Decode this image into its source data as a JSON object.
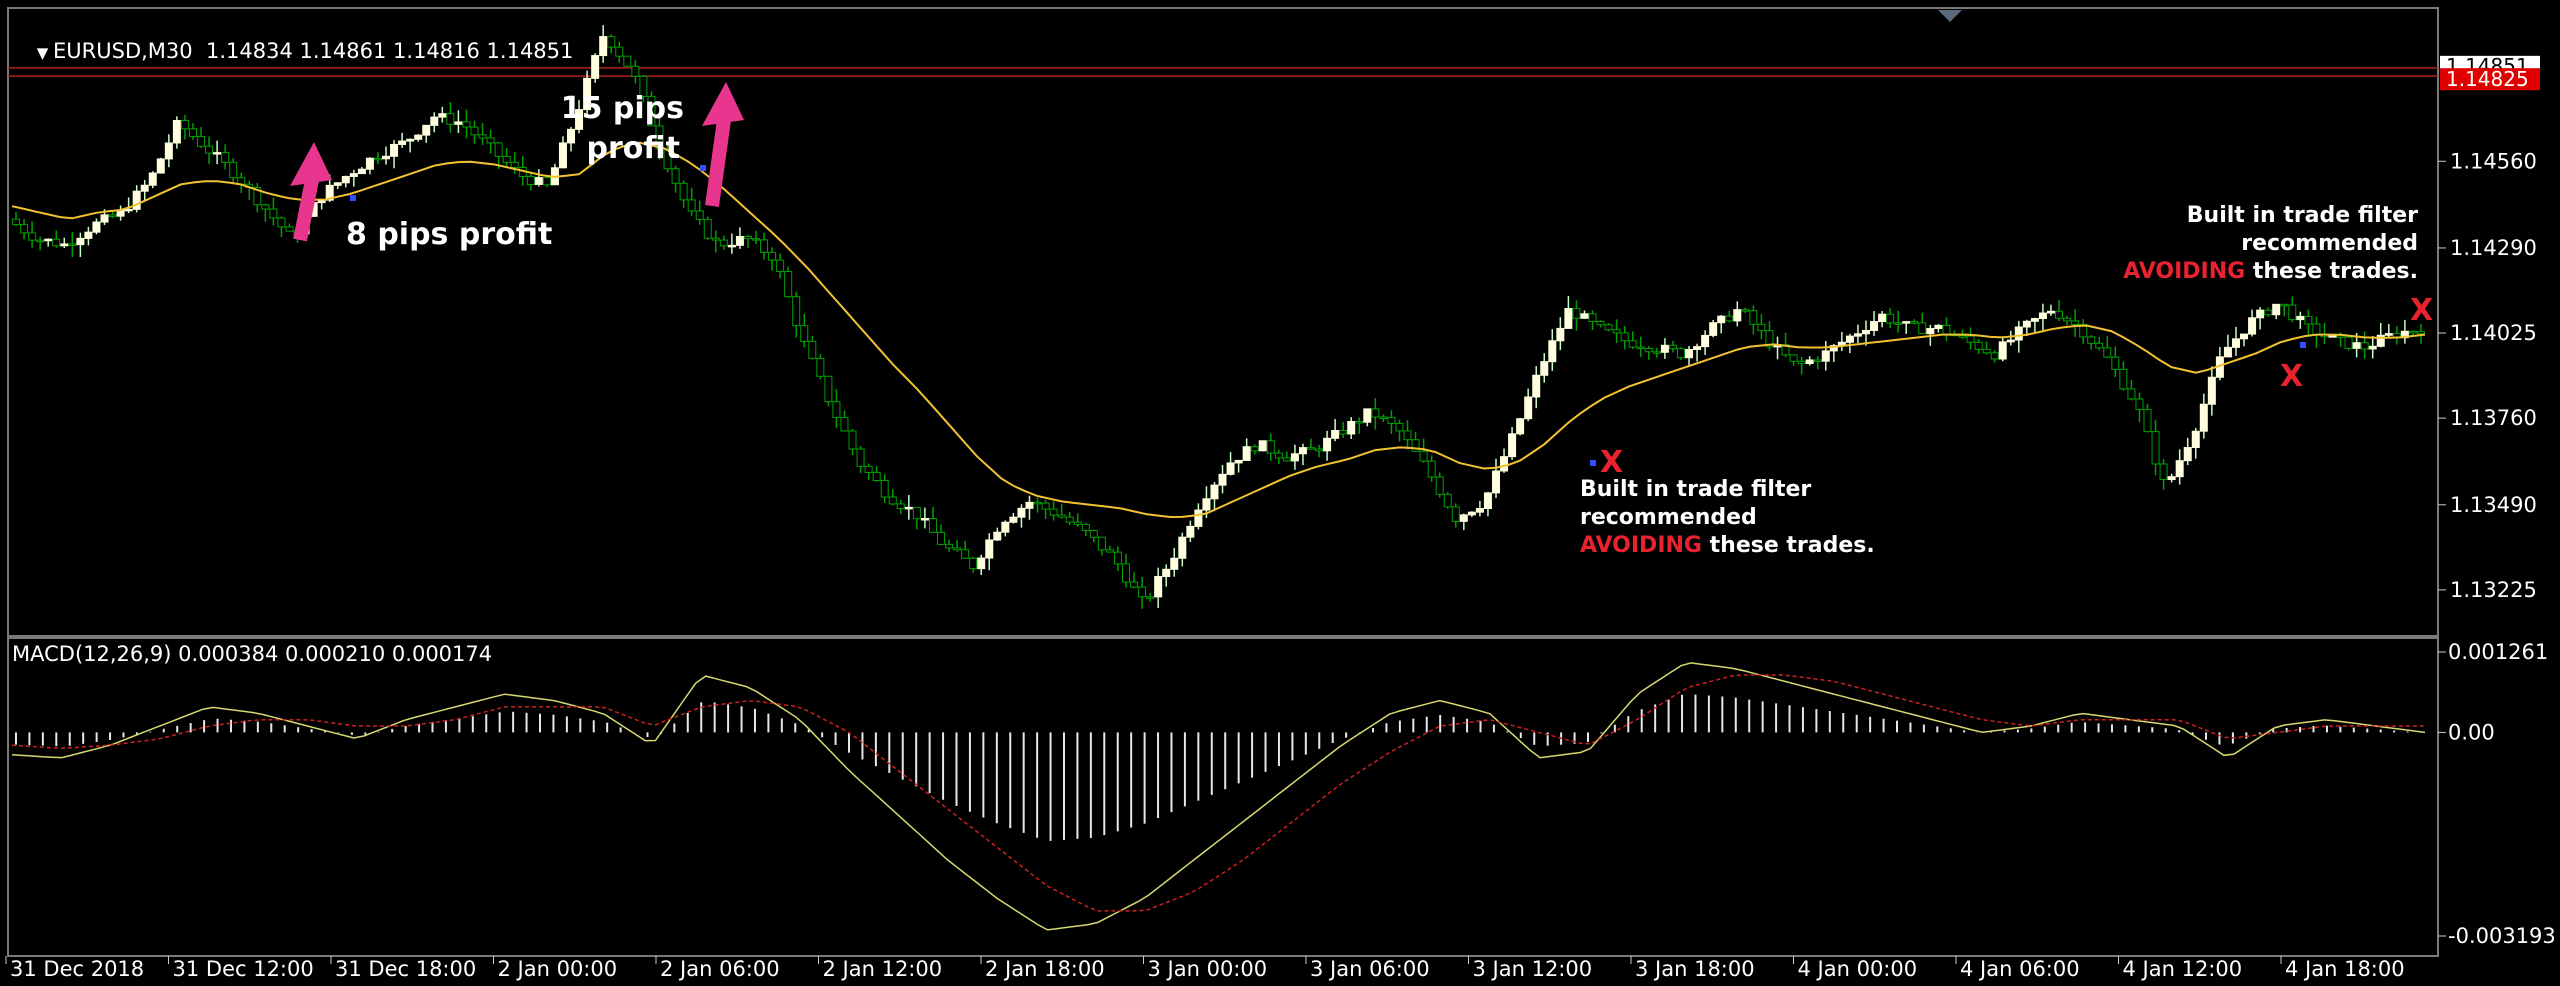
{
  "symbol_header": {
    "symbol": "EURUSD,M30",
    "ohlc": "1.14834 1.14861 1.14816 1.14851"
  },
  "macd_header": "MACD(12,26,9) 0.000384 0.000210 0.000174",
  "colors": {
    "background": "#000000",
    "bull_candle": "#ffffe0",
    "bear_candle": "#00a000",
    "moving_average": "#f2c230",
    "macd_signal": "#d02020",
    "annotation_arrow": "#e8368f",
    "annotation_red": "#e8232f",
    "bid_line": "#b02020"
  },
  "chart_data": [
    {
      "type": "candlestick",
      "panel": "main",
      "y_ticks": [
        "1.14560",
        "1.14290",
        "1.14025",
        "1.13760",
        "1.13490",
        "1.13225"
      ],
      "current_price": "1.14851",
      "red_price": "1.14825",
      "x_ticks": [
        "31 Dec 2018",
        "31 Dec 12:00",
        "31 Dec 18:00",
        "2 Jan 00:00",
        "2 Jan 06:00",
        "2 Jan 12:00",
        "2 Jan 18:00",
        "3 Jan 00:00",
        "3 Jan 06:00",
        "3 Jan 12:00",
        "3 Jan 18:00",
        "4 Jan 00:00",
        "4 Jan 06:00",
        "4 Jan 12:00",
        "4 Jan 18:00"
      ],
      "close_path": [
        1.1438,
        1.1432,
        1.143,
        1.1436,
        1.144,
        1.145,
        1.1468,
        1.146,
        1.1452,
        1.1442,
        1.1432,
        1.1445,
        1.1452,
        1.1458,
        1.1462,
        1.147,
        1.1468,
        1.146,
        1.1452,
        1.1448,
        1.147,
        1.1496,
        1.1484,
        1.146,
        1.144,
        1.143,
        1.1432,
        1.1426,
        1.14,
        1.138,
        1.1362,
        1.1352,
        1.1346,
        1.1336,
        1.133,
        1.1344,
        1.135,
        1.1346,
        1.134,
        1.1332,
        1.1318,
        1.1332,
        1.135,
        1.1362,
        1.1368,
        1.1364,
        1.1366,
        1.1372,
        1.1378,
        1.1372,
        1.136,
        1.1345,
        1.135,
        1.137,
        1.1392,
        1.141,
        1.1404,
        1.14,
        1.1398,
        1.1396,
        1.1404,
        1.141,
        1.14,
        1.1392,
        1.1396,
        1.1402,
        1.1408,
        1.1404,
        1.1404,
        1.14,
        1.1396,
        1.1404,
        1.141,
        1.1404,
        1.1394,
        1.138,
        1.1354,
        1.1372,
        1.1396,
        1.1406,
        1.1412,
        1.1404,
        1.14,
        1.1398,
        1.1402,
        1.1404
      ],
      "ma_path": [
        1.1442,
        1.144,
        1.1438,
        1.144,
        1.1441,
        1.1445,
        1.1449,
        1.145,
        1.1449,
        1.1446,
        1.1444,
        1.1444,
        1.1446,
        1.1449,
        1.1452,
        1.1455,
        1.1456,
        1.1455,
        1.1453,
        1.1451,
        1.1452,
        1.1459,
        1.1462,
        1.146,
        1.1455,
        1.1448,
        1.144,
        1.1432,
        1.1423,
        1.1413,
        1.1403,
        1.1393,
        1.1384,
        1.1374,
        1.1364,
        1.1356,
        1.1352,
        1.135,
        1.1349,
        1.1348,
        1.1346,
        1.1345,
        1.1346,
        1.135,
        1.1354,
        1.1358,
        1.1361,
        1.1363,
        1.1366,
        1.1367,
        1.1366,
        1.1362,
        1.136,
        1.1362,
        1.1368,
        1.1376,
        1.1382,
        1.1386,
        1.1389,
        1.1392,
        1.1395,
        1.1398,
        1.1399,
        1.1398,
        1.1398,
        1.1399,
        1.14,
        1.1401,
        1.1402,
        1.1402,
        1.1401,
        1.1402,
        1.1404,
        1.1405,
        1.1403,
        1.1398,
        1.1392,
        1.139,
        1.1393,
        1.1396,
        1.14,
        1.1402,
        1.1402,
        1.1401,
        1.1401,
        1.1402
      ],
      "ylim": [
        1.131,
        1.15
      ]
    },
    {
      "type": "histogram_with_lines",
      "panel": "macd",
      "y_ticks": [
        "0.001261",
        "0.00",
        "-0.003193"
      ],
      "ylim": [
        -0.003193,
        0.001261
      ],
      "macd": [
        -0.00035,
        -0.0004,
        -0.0002,
        0.0001,
        0.0004,
        0.0003,
        0.0001,
        -0.0001,
        0.0002,
        0.0004,
        0.0006,
        0.0005,
        0.0003,
        -0.0002,
        0.0009,
        0.0007,
        0.0002,
        -0.0006,
        -0.0013,
        -0.002,
        -0.0026,
        -0.0031,
        -0.003,
        -0.0026,
        -0.002,
        -0.0014,
        -0.0008,
        -0.0002,
        0.0003,
        0.0005,
        0.0003,
        -0.0004,
        -0.0003,
        0.0006,
        0.0011,
        0.001,
        0.0008,
        0.0006,
        0.0004,
        0.0002,
        0.0,
        0.0001,
        0.0003,
        0.0002,
        0.0001,
        -0.0004,
        0.0001,
        0.0002,
        0.0001,
        0.0
      ],
      "signal": [
        -0.0002,
        -0.00025,
        -0.0002,
        -0.0001,
        0.0001,
        0.0002,
        0.0002,
        0.0001,
        0.0001,
        0.0002,
        0.0004,
        0.0004,
        0.0004,
        0.0001,
        0.0004,
        0.0005,
        0.0004,
        0.0,
        -0.0006,
        -0.0012,
        -0.0018,
        -0.0024,
        -0.0028,
        -0.0028,
        -0.0025,
        -0.002,
        -0.0014,
        -0.0008,
        -0.0003,
        0.0001,
        0.0002,
        0.0,
        -0.0002,
        0.0002,
        0.0007,
        0.0009,
        0.0009,
        0.0008,
        0.0006,
        0.0004,
        0.0002,
        0.0001,
        0.0002,
        0.0002,
        0.0002,
        -0.0001,
        0.0,
        0.0001,
        0.0001,
        0.0001
      ]
    }
  ],
  "annotations": {
    "trade1": "8 pips profit",
    "trade2_line1": "15 pips",
    "trade2_line2": "profit",
    "filter_line1": "Built in trade filter",
    "filter_line2": "recommended",
    "filter_avoid": "AVOIDING",
    "filter_rest": " these trades.",
    "x_mark": "X"
  }
}
